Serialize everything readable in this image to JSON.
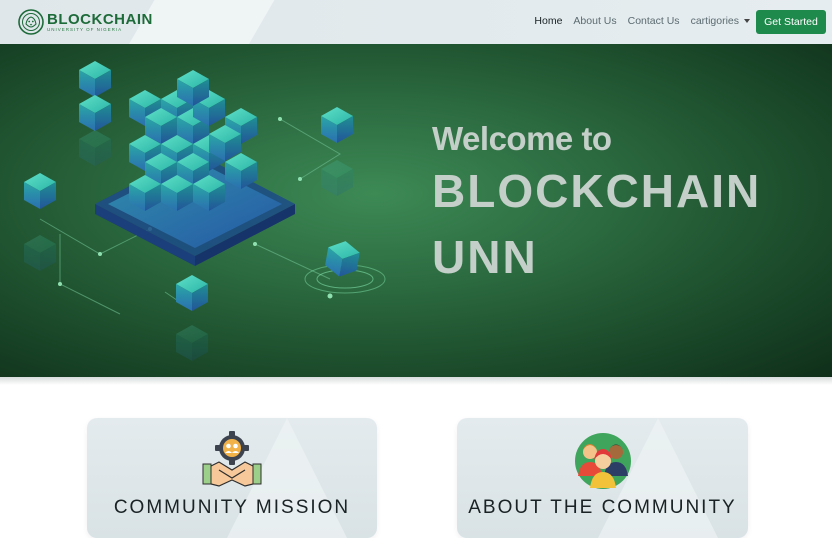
{
  "brand": {
    "title": "BLOCKCHAIN",
    "subtitle": "UNIVERSITY OF NIGERIA"
  },
  "nav": {
    "items": [
      {
        "label": "Home",
        "active": true
      },
      {
        "label": "About Us"
      },
      {
        "label": "Contact Us"
      },
      {
        "label": "cartigories",
        "dropdown": true
      }
    ],
    "cta": "Get Started"
  },
  "hero": {
    "welcome": "Welcome to",
    "line1": "BLOCKCHAIN",
    "line2": "UNN"
  },
  "cards": [
    {
      "title": "COMMUNITY MISSION",
      "icon": "handshake-gear-icon"
    },
    {
      "title": "ABOUT THE COMMUNITY",
      "icon": "people-group-icon"
    }
  ],
  "colors": {
    "accent": "#1e8a4c",
    "brand": "#1e6b3a",
    "hero_text": "#c3cfc8"
  }
}
